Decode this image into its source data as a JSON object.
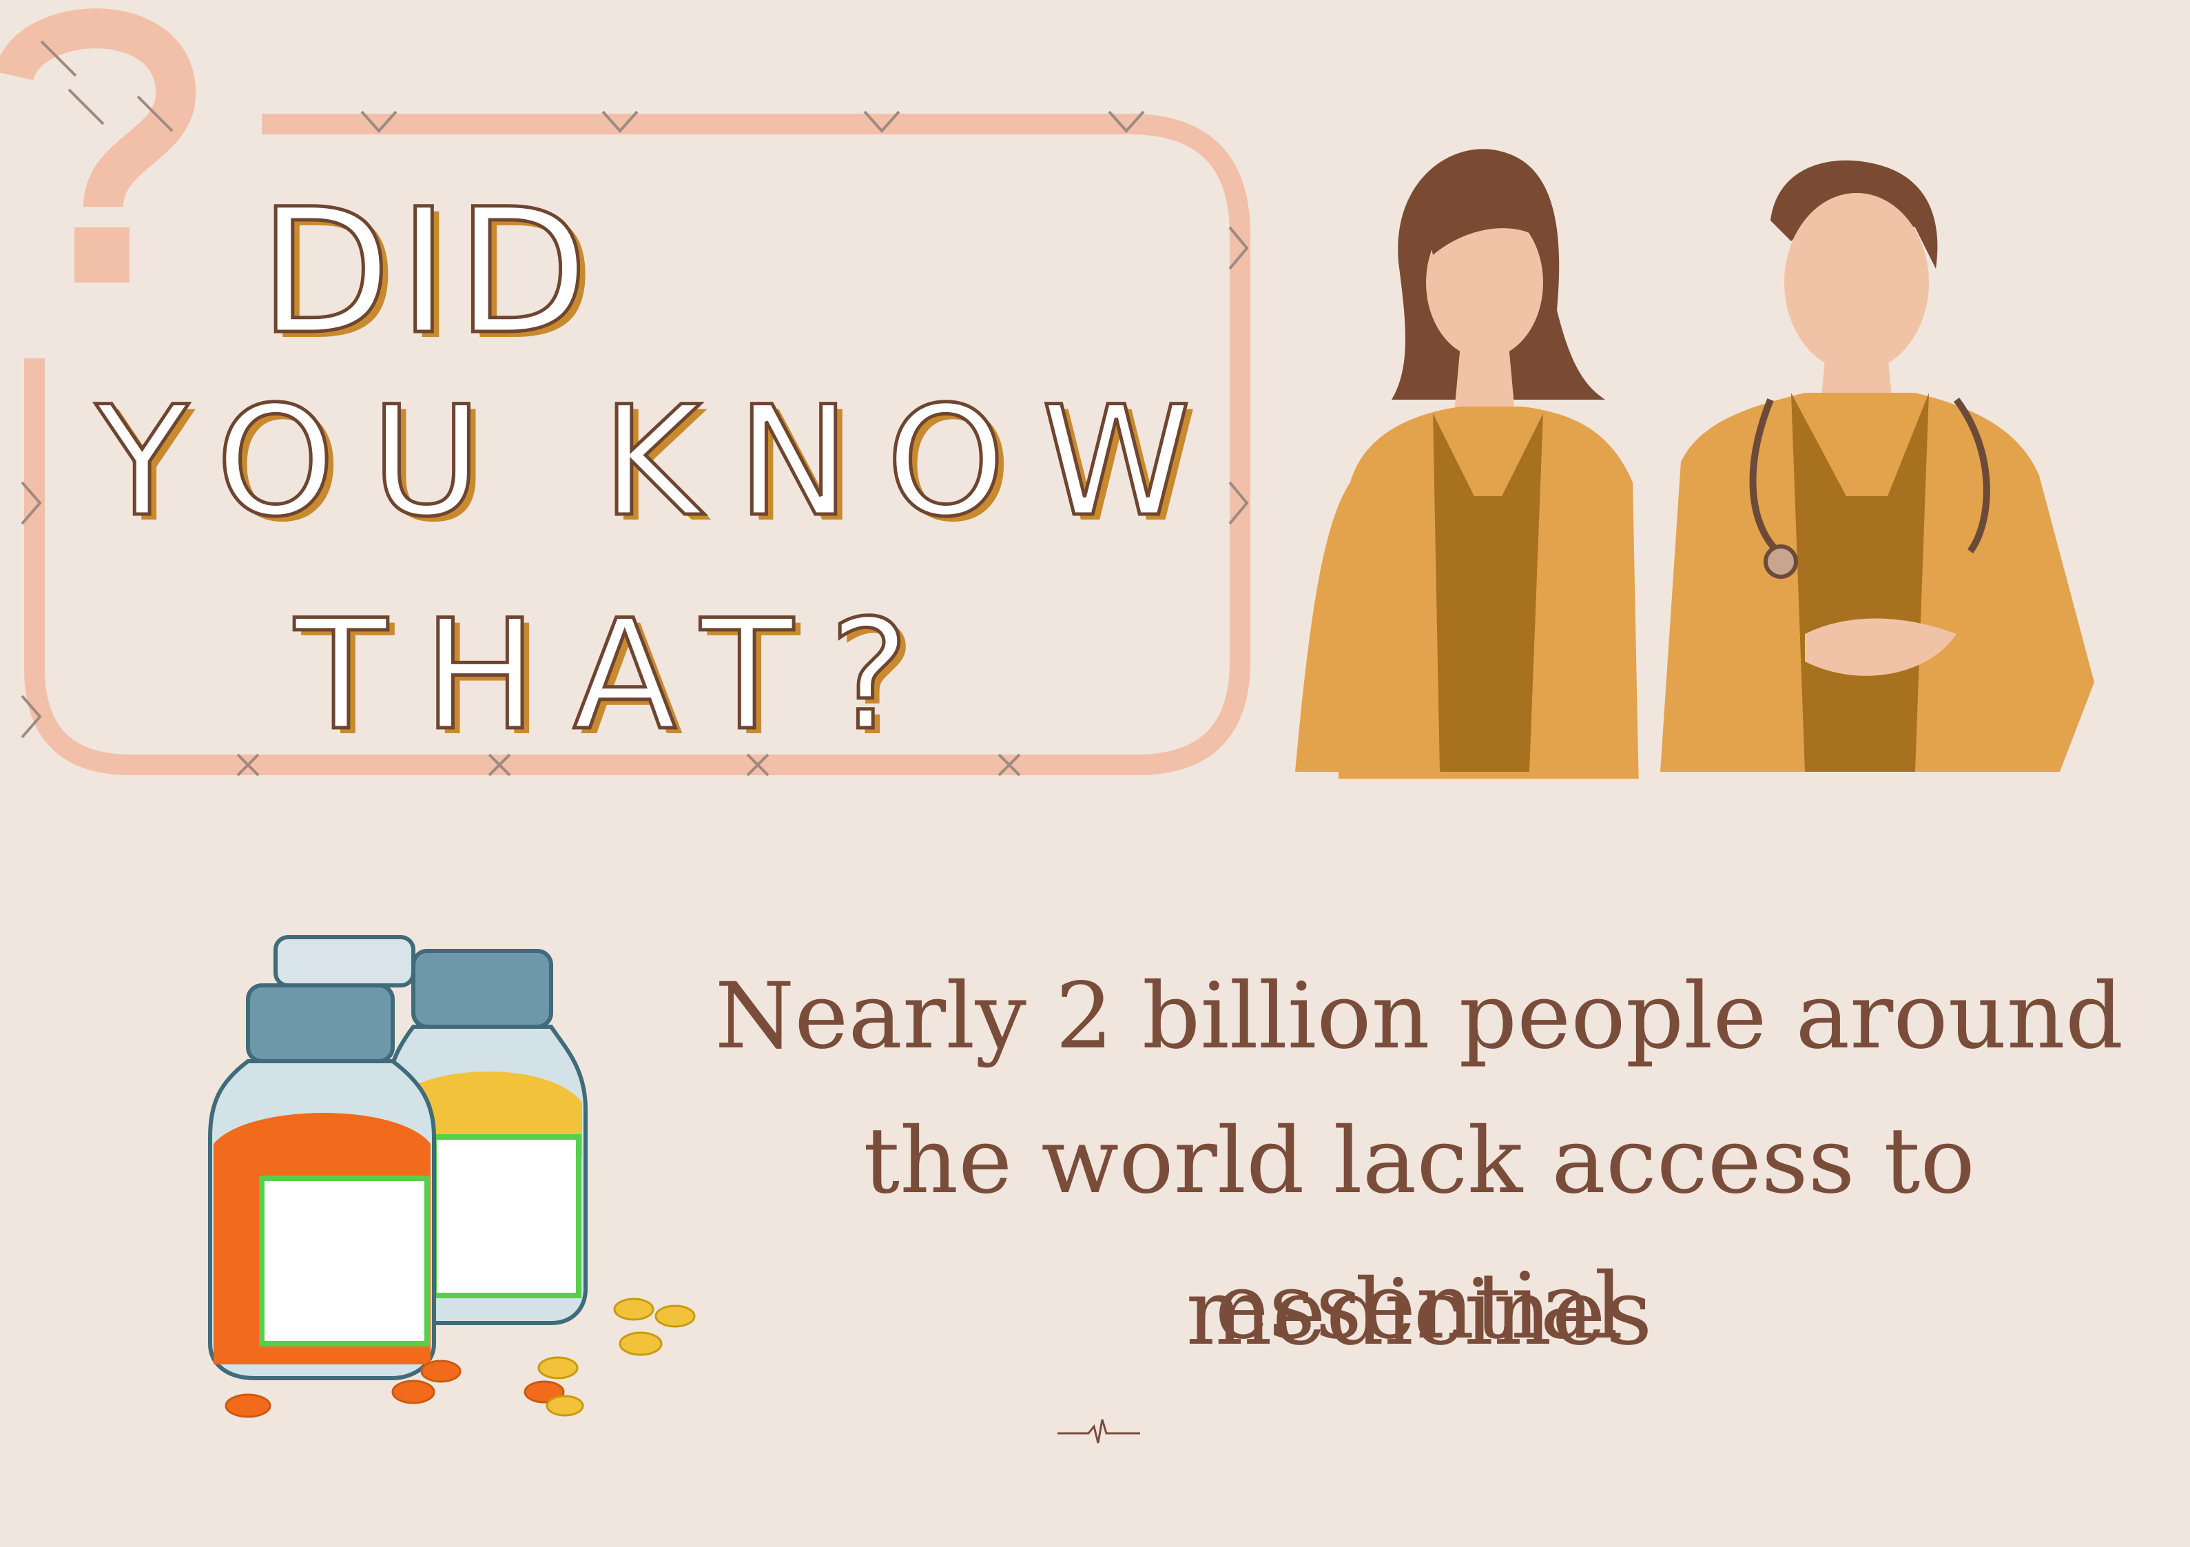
{
  "headline": {
    "line1": "DID",
    "line2": "YOU KNOW",
    "line3": "THAT?"
  },
  "fact": {
    "line1": "Nearly 2 billion people around",
    "line2": "the world lack access to essential",
    "line3": "medicines"
  },
  "colors": {
    "background": "#f0e6de",
    "frame": "#f2bfa8",
    "headline_stroke": "#6e4530",
    "headline_shadow": "#c98a2e",
    "text": "#7a4c3a"
  },
  "icons": [
    "question-mark-icon",
    "doctors-illustration",
    "medicine-bottles-illustration",
    "heartbeat-icon"
  ]
}
